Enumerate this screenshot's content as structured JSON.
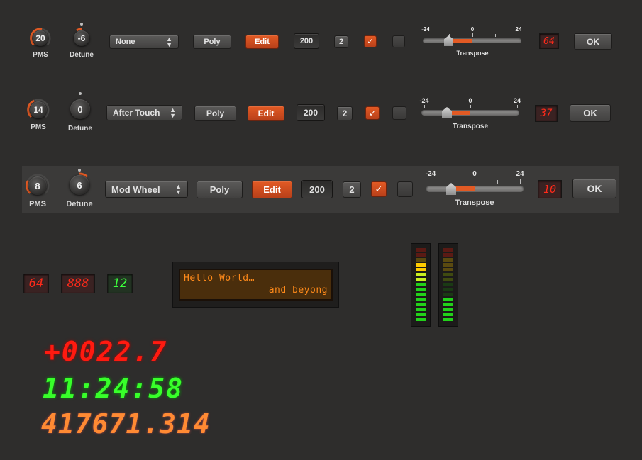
{
  "rows": [
    {
      "pms_value": "20",
      "pms_label": "PMS",
      "detune_value": "-6",
      "detune_label": "Detune",
      "source_value": "None",
      "mode_label": "Poly",
      "edit_label": "Edit",
      "amount_value": "200",
      "voices_value": "2",
      "check_mark": "✓",
      "slider": {
        "min_label": "-24",
        "mid_label": "0",
        "max_label": "24",
        "label": "Transpose",
        "value": -6
      },
      "seg_value": "64",
      "ok_label": "OK"
    },
    {
      "pms_value": "14",
      "pms_label": "PMS",
      "detune_value": "0",
      "detune_label": "Detune",
      "source_value": "After Touch",
      "mode_label": "Poly",
      "edit_label": "Edit",
      "amount_value": "200",
      "voices_value": "2",
      "check_mark": "✓",
      "slider": {
        "min_label": "-24",
        "mid_label": "0",
        "max_label": "24",
        "label": "Transpose",
        "value": -6
      },
      "seg_value": "37",
      "ok_label": "OK"
    },
    {
      "pms_value": "8",
      "pms_label": "PMS",
      "detune_value": "6",
      "detune_label": "Detune",
      "source_value": "Mod Wheel",
      "mode_label": "Poly",
      "edit_label": "Edit",
      "amount_value": "200",
      "voices_value": "2",
      "check_mark": "✓",
      "slider": {
        "min_label": "-24",
        "mid_label": "0",
        "max_label": "24",
        "label": "Transpose",
        "value": -6
      },
      "seg_value": "10",
      "ok_label": "OK"
    }
  ],
  "small_displays": {
    "red_a": "64",
    "red_b": "888",
    "green": "12"
  },
  "lcd": {
    "line1": "Hello World…",
    "line2": "and beyong"
  },
  "meters": [
    {
      "level_fraction": 0.8
    },
    {
      "level_fraction": 0.3
    }
  ],
  "big_displays": {
    "red": "+0022.7",
    "clock": "11:24:58",
    "orange": "417671.314"
  },
  "colors": {
    "accent": "#e25a24",
    "red_led": "#ff2a1a",
    "green_led": "#3cff3c",
    "lcd_text": "#ff8a1a",
    "background": "#2e2d2c"
  }
}
